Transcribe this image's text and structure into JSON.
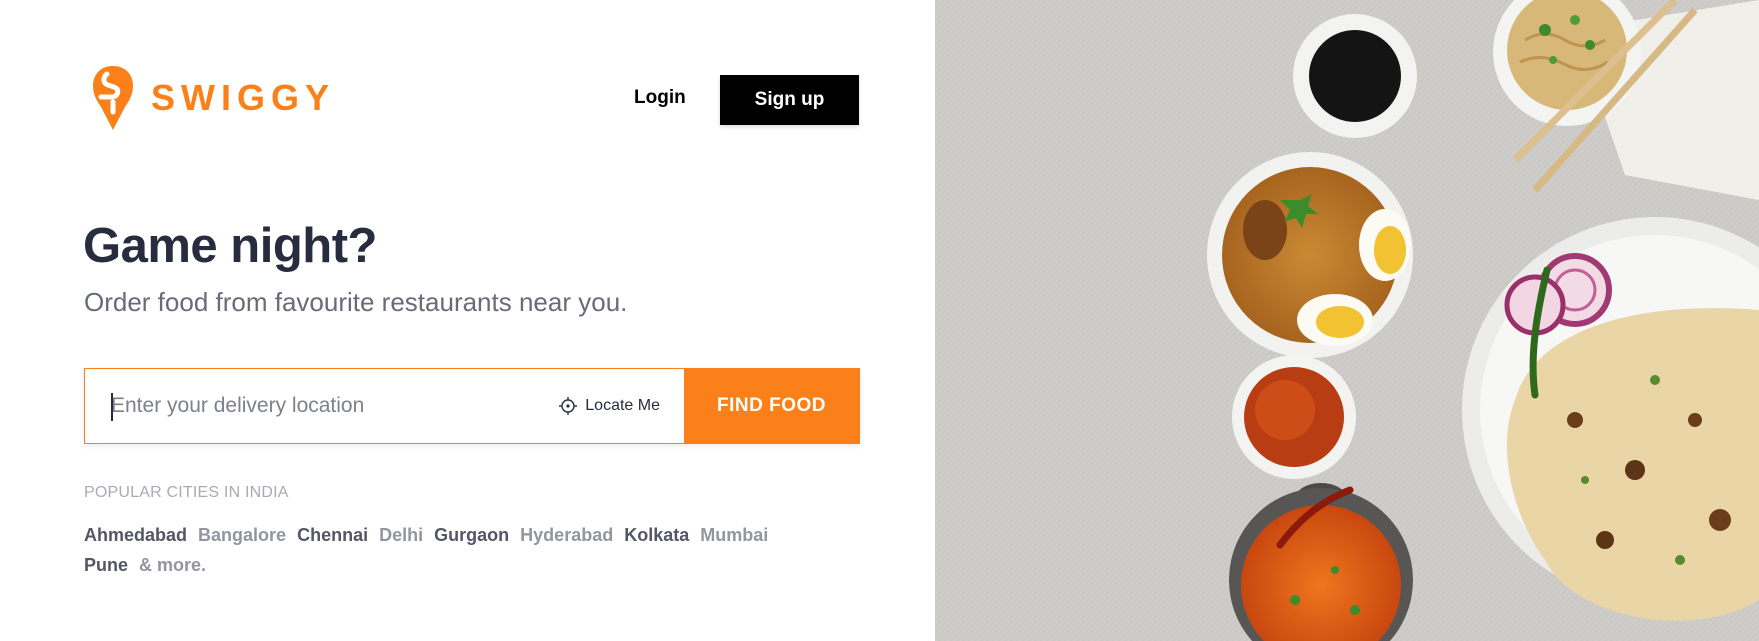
{
  "brand": {
    "name": "SWIGGY",
    "accent": "#fc8019"
  },
  "header": {
    "login_label": "Login",
    "signup_label": "Sign up"
  },
  "hero": {
    "headline": "Game night?",
    "subheadline": "Order food from favourite restaurants near you."
  },
  "search": {
    "placeholder": "Enter your delivery location",
    "locate_label": "Locate Me",
    "find_label": "FIND FOOD"
  },
  "popular": {
    "title": "POPULAR CITIES IN INDIA",
    "cities": [
      "Ahmedabad",
      "Bangalore",
      "Chennai",
      "Delhi",
      "Gurgaon",
      "Hyderabad",
      "Kolkata",
      "Mumbai",
      "Pune"
    ],
    "more_label": "& more."
  },
  "icons": [
    "swiggy-logo-icon",
    "crosshair-icon"
  ]
}
